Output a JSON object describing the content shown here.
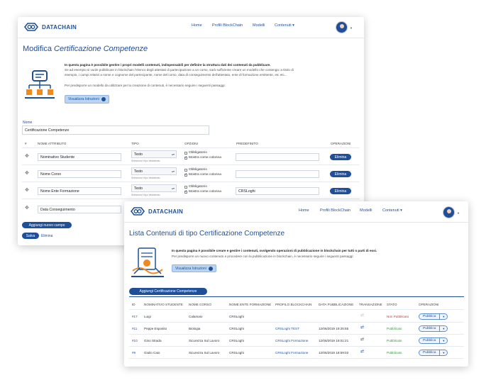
{
  "back": {
    "brand": "DATACHAIN",
    "nav": [
      "Home",
      "Profili BlockChain",
      "Modelli",
      "Contenuti"
    ],
    "title_prefix": "Modifica",
    "title_italic": "Certificazione Competenze",
    "info_bold": "In questa pagina è possibile gestire i propri modelli contenuti, indispensabili per definire la struttura dati dei contenuti da pubblicare.",
    "info_line1": "Se ad esempio si vuole pubblicare in blockchain l'elenco degli attestati di partecipazione a un corso, sarà sufficiente creare un modello che contenga: a titolo di",
    "info_line2": "esempio, i campi relativi a nome e cognome del partecipante, nome del corso, data di conseguimento dell'attestato, ente di formazione emittente, etc etc...",
    "info_line3": "Per predisporre un modello da utilizzare per la creazione di contenuti, è necessario seguire i seguenti passaggi:",
    "instructions_button": "Visualizza Istruzioni",
    "name_label": "Nome",
    "name_value": "Certificazione Competenze",
    "columns": [
      "#",
      "NOME ATTRIBUTO",
      "TIPO",
      "OPZIONI",
      "PREDEFINITO",
      "OPERAZIONI"
    ],
    "type_hint": "Seleziona il tipo desiderato",
    "opt_required": "Obbligatorio",
    "opt_show_col": "Mostra come colonna",
    "delete_label": "Elimina",
    "rows": [
      {
        "name": "Nominativo Studente",
        "type": "Testo",
        "default": ""
      },
      {
        "name": "Nome Corso",
        "type": "Testo",
        "default": ""
      },
      {
        "name": "Nome Ente Formazione",
        "type": "Testo",
        "default": "CRSLoghi"
      },
      {
        "name": "Data Conseguimento",
        "type": "",
        "default": ""
      }
    ],
    "add_field": "Aggiungi nuovo campo",
    "save": "Salva",
    "delete": "Elimina"
  },
  "front": {
    "brand": "DATACHAIN",
    "nav": [
      "Home",
      "Profili BlockChain",
      "Modelli",
      "Contenuti"
    ],
    "title": "Lista Contenuti di tipo Certificazione Competenze",
    "info_bold": "In questa pagina è possibile creare e gestire i contenuti, svolgendo operazioni di pubblicazione in blockchain per tutti o parti di essi.",
    "info_line1": "Per predisporre un nuovo contenuto e procedere con la pubblicazione in blockchain, è necessario seguire i seguenti passaggi:",
    "instructions_button": "Visualizza Istruzioni",
    "add_button": "Aggiungi Certificazione Competenze",
    "columns": [
      "ID",
      "NOMINATIVO STUDENTE",
      "NOME CORSO",
      "NOME ENTE FORMAZIONE",
      "PROFILO BLOCKCHAIN",
      "DATA PUBBLICAZIONE",
      "TRANSAZIONE",
      "STATO",
      "OPERAZIONI"
    ],
    "publish": "Pubblica",
    "rows": [
      {
        "id": "#17",
        "student": "Luigi",
        "course": "Calamaio",
        "ente": "CRSLoghi",
        "profile": "",
        "date": "",
        "status": "Non Pubblicato",
        "published": false
      },
      {
        "id": "#11",
        "student": "Peppe Esposito",
        "course": "Biologia",
        "ente": "CRSLoghi",
        "profile": "CRSLoghi TEST",
        "date": "12/06/2019 19:25:55",
        "status": "Pubblicato",
        "published": true
      },
      {
        "id": "#10",
        "student": "Gino Strada",
        "course": "Sicurezza Sul Lavoro",
        "ente": "CRSLoghi",
        "profile": "CRSLoghi Formazione",
        "date": "12/06/2019 18:01:21",
        "status": "Pubblicato",
        "published": true
      },
      {
        "id": "#9",
        "student": "Giulio Caio",
        "course": "Sicurezza Sul Lavoro",
        "ente": "CRSLoghi",
        "profile": "CRSLoghi Formazione",
        "date": "12/06/2019 18:59:02",
        "status": "Pubblicato",
        "published": true
      }
    ]
  },
  "colors": {
    "brand_blue": "#1f4f99",
    "status_red": "#d9342b",
    "status_green": "#2d9a3d"
  }
}
